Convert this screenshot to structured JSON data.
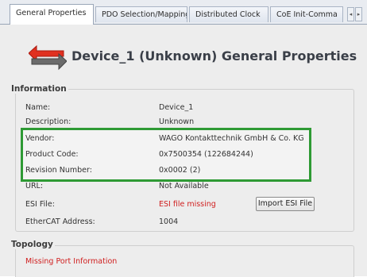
{
  "tabs": [
    {
      "label": "General Properties",
      "active": true
    },
    {
      "label": "PDO Selection/Mapping",
      "active": false
    },
    {
      "label": "Distributed Clock",
      "active": false
    },
    {
      "label": "CoE Init-Comma",
      "active": false
    }
  ],
  "header": {
    "title": "Device_1 (Unknown) General Properties",
    "icon": "arrows-red-gray-icon"
  },
  "information": {
    "title": "Information",
    "rows": [
      {
        "label": "Name:",
        "value": "Device_1"
      },
      {
        "label": "Description:",
        "value": "Unknown"
      },
      {
        "label": "Vendor:",
        "value": "WAGO Kontakttechnik GmbH & Co. KG"
      },
      {
        "label": "Product Code:",
        "value": "0x7500354 (122684244)"
      },
      {
        "label": "Revision Number:",
        "value": "0x0002 (2)"
      },
      {
        "label": "URL:",
        "value": "Not Available"
      },
      {
        "label": "ESI File:",
        "value": "ESI file missing"
      },
      {
        "label": "EtherCAT Address:",
        "value": "1004"
      }
    ],
    "import_button": "Import ESI File"
  },
  "topology": {
    "title": "Topology",
    "message": "Missing Port Information"
  },
  "colors": {
    "highlight": "#2e9a34",
    "error": "#d02020",
    "arrow_red": "#e03020",
    "arrow_gray": "#6b6b6b"
  }
}
